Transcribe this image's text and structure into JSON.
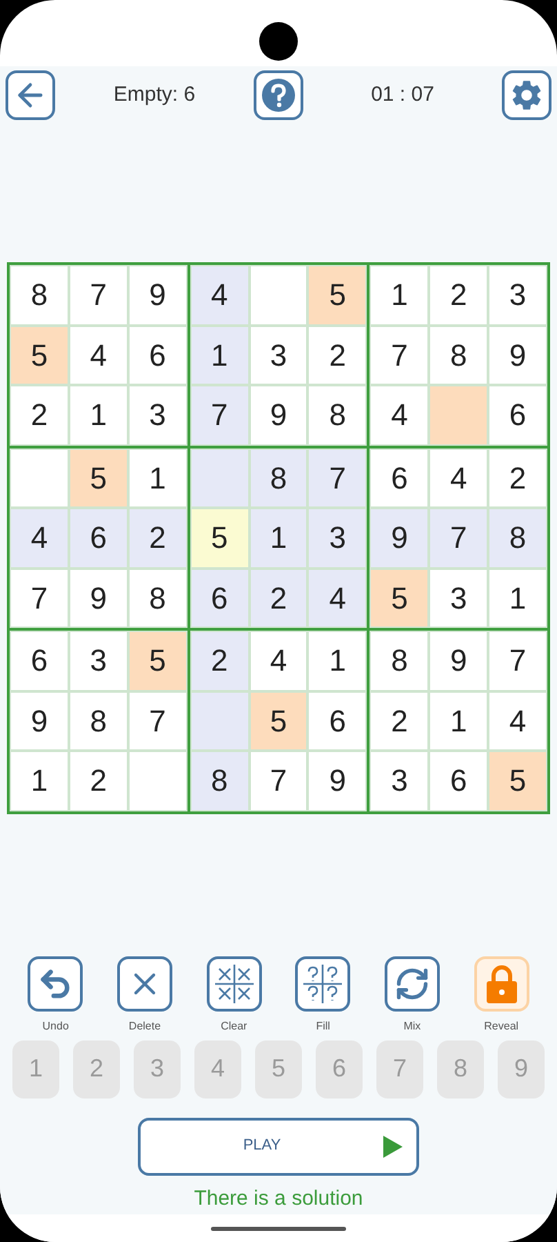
{
  "header": {
    "empty_label": "Empty: 6",
    "timer": "01 : 07"
  },
  "grid": [
    [
      {
        "value": "8",
        "kind": "plain",
        "selected": false
      },
      {
        "value": "7",
        "kind": "plain",
        "selected": false
      },
      {
        "value": "9",
        "kind": "plain",
        "selected": false
      },
      {
        "value": "4",
        "kind": "peer",
        "selected": false
      },
      {
        "kind": "plain",
        "selected": false
      },
      {
        "value": "5",
        "kind": "match",
        "selected": false
      },
      {
        "value": "1",
        "kind": "plain",
        "selected": false
      },
      {
        "value": "2",
        "kind": "plain",
        "selected": false
      },
      {
        "value": "3",
        "kind": "plain",
        "selected": false
      }
    ],
    [
      {
        "value": "5",
        "kind": "match",
        "selected": false
      },
      {
        "value": "4",
        "kind": "plain",
        "selected": false
      },
      {
        "value": "6",
        "kind": "plain",
        "selected": false
      },
      {
        "value": "1",
        "kind": "peer",
        "selected": false
      },
      {
        "value": "3",
        "kind": "plain",
        "selected": false
      },
      {
        "value": "2",
        "kind": "plain",
        "selected": false
      },
      {
        "value": "7",
        "kind": "plain",
        "selected": false
      },
      {
        "value": "8",
        "kind": "plain",
        "selected": false
      },
      {
        "value": "9",
        "kind": "plain",
        "selected": false
      }
    ],
    [
      {
        "value": "2",
        "kind": "plain",
        "selected": false
      },
      {
        "value": "1",
        "kind": "plain",
        "selected": false
      },
      {
        "value": "3",
        "kind": "plain",
        "selected": false
      },
      {
        "value": "7",
        "kind": "peer",
        "selected": false
      },
      {
        "value": "9",
        "kind": "plain",
        "selected": false
      },
      {
        "value": "8",
        "kind": "plain",
        "selected": false
      },
      {
        "value": "4",
        "kind": "plain",
        "selected": false
      },
      {
        "kind": "match",
        "selected": false
      },
      {
        "value": "6",
        "kind": "plain",
        "selected": false
      }
    ],
    [
      {
        "kind": "plain",
        "selected": false
      },
      {
        "value": "5",
        "kind": "match",
        "selected": false
      },
      {
        "value": "1",
        "kind": "plain",
        "selected": false
      },
      {
        "kind": "peer",
        "selected": false
      },
      {
        "value": "8",
        "kind": "peer",
        "selected": false
      },
      {
        "value": "7",
        "kind": "peer",
        "selected": false
      },
      {
        "value": "6",
        "kind": "plain",
        "selected": false
      },
      {
        "value": "4",
        "kind": "plain",
        "selected": false
      },
      {
        "value": "2",
        "kind": "plain",
        "selected": false
      }
    ],
    [
      {
        "value": "4",
        "kind": "peer",
        "selected": false
      },
      {
        "value": "6",
        "kind": "peer",
        "selected": false
      },
      {
        "value": "2",
        "kind": "peer",
        "selected": false
      },
      {
        "value": "5",
        "kind": "peer",
        "selected": true
      },
      {
        "value": "1",
        "kind": "peer",
        "selected": false
      },
      {
        "value": "3",
        "kind": "peer",
        "selected": false
      },
      {
        "value": "9",
        "kind": "peer",
        "selected": false
      },
      {
        "value": "7",
        "kind": "peer",
        "selected": false
      },
      {
        "value": "8",
        "kind": "peer",
        "selected": false
      }
    ],
    [
      {
        "value": "7",
        "kind": "plain",
        "selected": false
      },
      {
        "value": "9",
        "kind": "plain",
        "selected": false
      },
      {
        "value": "8",
        "kind": "plain",
        "selected": false
      },
      {
        "value": "6",
        "kind": "peer",
        "selected": false
      },
      {
        "value": "2",
        "kind": "peer",
        "selected": false
      },
      {
        "value": "4",
        "kind": "peer",
        "selected": false
      },
      {
        "value": "5",
        "kind": "match",
        "selected": false
      },
      {
        "value": "3",
        "kind": "plain",
        "selected": false
      },
      {
        "value": "1",
        "kind": "plain",
        "selected": false
      }
    ],
    [
      {
        "value": "6",
        "kind": "plain",
        "selected": false
      },
      {
        "value": "3",
        "kind": "plain",
        "selected": false
      },
      {
        "value": "5",
        "kind": "match",
        "selected": false
      },
      {
        "value": "2",
        "kind": "peer",
        "selected": false
      },
      {
        "value": "4",
        "kind": "plain",
        "selected": false
      },
      {
        "value": "1",
        "kind": "plain",
        "selected": false
      },
      {
        "value": "8",
        "kind": "plain",
        "selected": false
      },
      {
        "value": "9",
        "kind": "plain",
        "selected": false
      },
      {
        "value": "7",
        "kind": "plain",
        "selected": false
      }
    ],
    [
      {
        "value": "9",
        "kind": "plain",
        "selected": false
      },
      {
        "value": "8",
        "kind": "plain",
        "selected": false
      },
      {
        "value": "7",
        "kind": "plain",
        "selected": false
      },
      {
        "kind": "peer",
        "selected": false
      },
      {
        "value": "5",
        "kind": "match",
        "selected": false
      },
      {
        "value": "6",
        "kind": "plain",
        "selected": false
      },
      {
        "value": "2",
        "kind": "plain",
        "selected": false
      },
      {
        "value": "1",
        "kind": "plain",
        "selected": false
      },
      {
        "value": "4",
        "kind": "plain",
        "selected": false
      }
    ],
    [
      {
        "value": "1",
        "kind": "plain",
        "selected": false
      },
      {
        "value": "2",
        "kind": "plain",
        "selected": false
      },
      {
        "kind": "plain",
        "selected": false
      },
      {
        "value": "8",
        "kind": "peer",
        "selected": false
      },
      {
        "value": "7",
        "kind": "plain",
        "selected": false
      },
      {
        "value": "9",
        "kind": "plain",
        "selected": false
      },
      {
        "value": "3",
        "kind": "plain",
        "selected": false
      },
      {
        "value": "6",
        "kind": "plain",
        "selected": false
      },
      {
        "value": "5",
        "kind": "match",
        "selected": false
      }
    ]
  ],
  "tools": [
    {
      "kind": "undo",
      "label": "Undo"
    },
    {
      "kind": "delete",
      "label": "Delete"
    },
    {
      "kind": "clear",
      "label": "Clear"
    },
    {
      "kind": "fill",
      "label": "Fill"
    },
    {
      "kind": "mix",
      "label": "Mix"
    },
    {
      "kind": "reveal",
      "label": "Reveal"
    }
  ],
  "number_pad": [
    {
      "label": "1",
      "disabled": true
    },
    {
      "label": "2",
      "disabled": true
    },
    {
      "label": "3",
      "disabled": true
    },
    {
      "label": "4",
      "disabled": true
    },
    {
      "label": "5",
      "disabled": true
    },
    {
      "label": "6",
      "disabled": true
    },
    {
      "label": "7",
      "disabled": true
    },
    {
      "label": "8",
      "disabled": true
    },
    {
      "label": "9",
      "disabled": true
    }
  ],
  "play_button": {
    "label": "PLAY"
  },
  "status": "There is a solution"
}
